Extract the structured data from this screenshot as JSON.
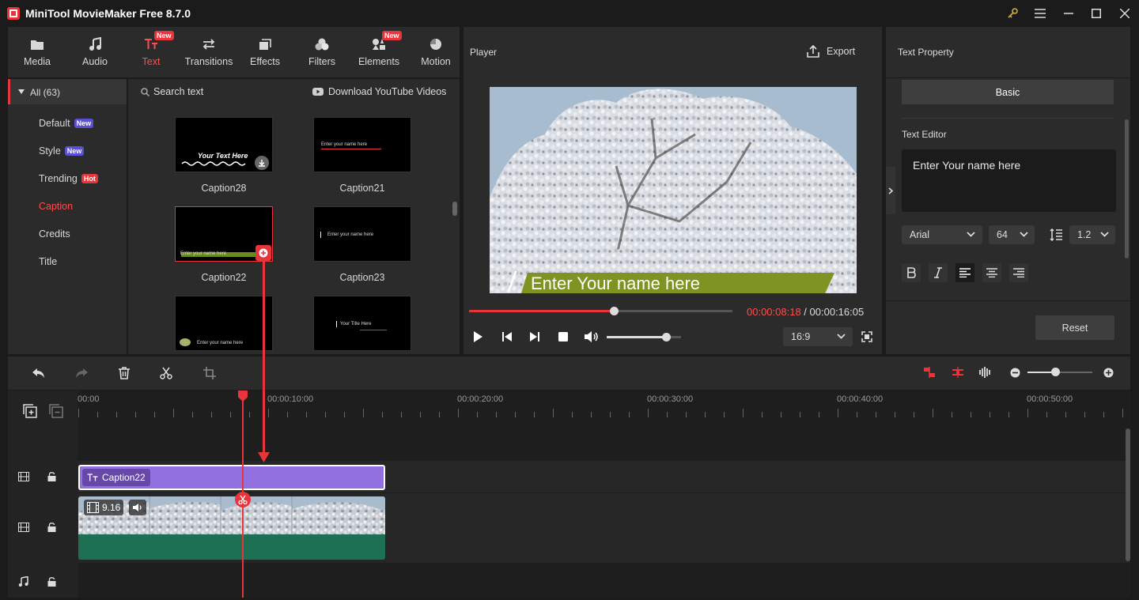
{
  "window": {
    "title": "MiniTool MovieMaker Free 8.7.0",
    "accent": "#e8343b"
  },
  "tabs": [
    {
      "label": "Media",
      "icon": "folder-icon"
    },
    {
      "label": "Audio",
      "icon": "music-note-icon"
    },
    {
      "label": "Text",
      "icon": "text-icon",
      "badge": "New",
      "active": true
    },
    {
      "label": "Transitions",
      "icon": "transitions-icon"
    },
    {
      "label": "Effects",
      "icon": "effects-icon"
    },
    {
      "label": "Filters",
      "icon": "filters-icon"
    },
    {
      "label": "Elements",
      "icon": "elements-icon",
      "badge": "New"
    },
    {
      "label": "Motion",
      "icon": "motion-icon"
    }
  ],
  "categories": {
    "all": "All (63)",
    "items": [
      {
        "label": "Default",
        "tag": "New"
      },
      {
        "label": "Style",
        "tag": "New"
      },
      {
        "label": "Trending",
        "tag": "Hot"
      },
      {
        "label": "Caption",
        "active": true
      },
      {
        "label": "Credits"
      },
      {
        "label": "Title"
      }
    ]
  },
  "library": {
    "search": "Search text",
    "download": "Download YouTube Videos",
    "items": [
      {
        "label": "Caption28",
        "preview": "Your Text Here"
      },
      {
        "label": "Caption21",
        "preview": "Enter your name here"
      },
      {
        "label": "Caption22",
        "preview": "Enter your name here"
      },
      {
        "label": "Caption23",
        "preview": "Enter your name here"
      },
      {
        "label": "",
        "preview": "Enter your name here"
      },
      {
        "label": "",
        "preview": "Your Title Here"
      }
    ]
  },
  "player": {
    "title": "Player",
    "export": "Export",
    "caption_text": "Enter Your name here",
    "current_time": "00:00:08:18",
    "separator": " / ",
    "total_time": "00:00:16:05",
    "progress": 0.55,
    "volume": 0.8,
    "aspect": "16:9"
  },
  "property": {
    "title": "Text Property",
    "tab": "Basic",
    "editor_label": "Text Editor",
    "text": "Enter Your name here",
    "font": "Arial",
    "size": "64",
    "line_spacing": "1.2",
    "reset": "Reset"
  },
  "timeline": {
    "ruler": [
      "00:00",
      "00:00:10:00",
      "00:00:20:00",
      "00:00:30:00",
      "00:00:40:00",
      "00:00:50:00"
    ],
    "text_clip": "Caption22",
    "video_speed": "9.16"
  }
}
